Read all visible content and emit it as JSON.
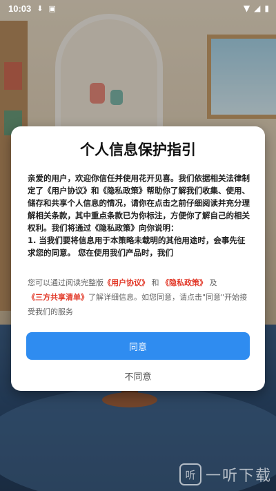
{
  "status_bar": {
    "time": "10:03",
    "icons": [
      "download-icon",
      "notification-icon",
      "wifi-icon",
      "signal-icon",
      "battery-icon"
    ]
  },
  "dialog": {
    "title": "个人信息保护指引",
    "body": [
      "亲爱的用户，欢迎你信任并使用花开见喜。我们依据相关法律制定了《用户协议》和《隐私政策》帮助你了解我们收集、使用、储存和共享个人信息的情况，请你在点击之前仔细阅读并充分理解相关条款，其中重点条款已为你标注，方便你了解自己的相关权利。我们将通过《隐私政策》向你说明：",
      "1. 当我们要将信息用于本策略未载明的其他用途时，会事先征求您的同意。 您在使用我们产品时，我们"
    ],
    "notice": {
      "prefix": "您可以通过阅读完整版",
      "user_agreement": "《用户协议》",
      "and": "和",
      "privacy_policy": "《隐私政策》",
      "and2": "及",
      "third_party": "《三方共享清单》",
      "suffix": "了解详细信息。如您同意，请点击\"同意\"开始接受我们的服务"
    },
    "agree_label": "同意",
    "disagree_label": "不同意"
  },
  "watermark": {
    "badge": "听",
    "text": "一听下载"
  }
}
